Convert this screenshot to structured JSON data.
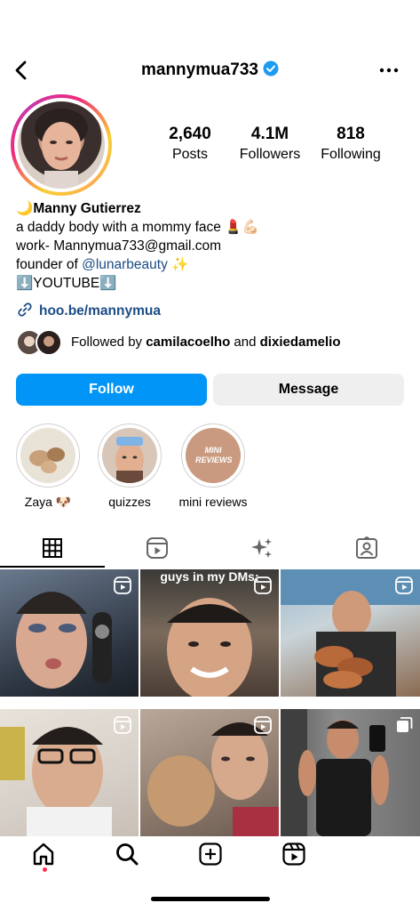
{
  "header": {
    "username": "mannymua733",
    "verified": true
  },
  "profile": {
    "stats": [
      {
        "value": "2,640",
        "label": "Posts"
      },
      {
        "value": "4.1M",
        "label": "Followers"
      },
      {
        "value": "818",
        "label": "Following"
      }
    ],
    "name_emoji": "🌙",
    "name": "Manny Gutierrez",
    "bio_line1": "a daddy body with a mommy face 💄💪🏻",
    "bio_line2": "work- Mannymua733@gmail.com",
    "bio_line3_prefix": "founder of ",
    "bio_line3_mention": "@lunarbeauty",
    "bio_line3_suffix": " ✨",
    "bio_line4": "⬇️YOUTUBE⬇️",
    "link": "hoo.be/mannymua",
    "followed_prefix": "Followed by ",
    "followed_user1": "camilacoelho",
    "followed_and": " and ",
    "followed_user2": "dixiedamelio"
  },
  "actions": {
    "follow_label": "Follow",
    "message_label": "Message"
  },
  "highlights": [
    {
      "label": "Zaya 🐶"
    },
    {
      "label": "quizzes"
    },
    {
      "label": "mini reviews",
      "cover_text": "MINI REVIEWS"
    }
  ],
  "grid": {
    "captions": [
      "guys in my DMs:"
    ]
  },
  "colors": {
    "accent": "#0095f6",
    "link": "#1b4c85",
    "message_bg": "#efefef",
    "notif_dot": "#ff2d55"
  }
}
